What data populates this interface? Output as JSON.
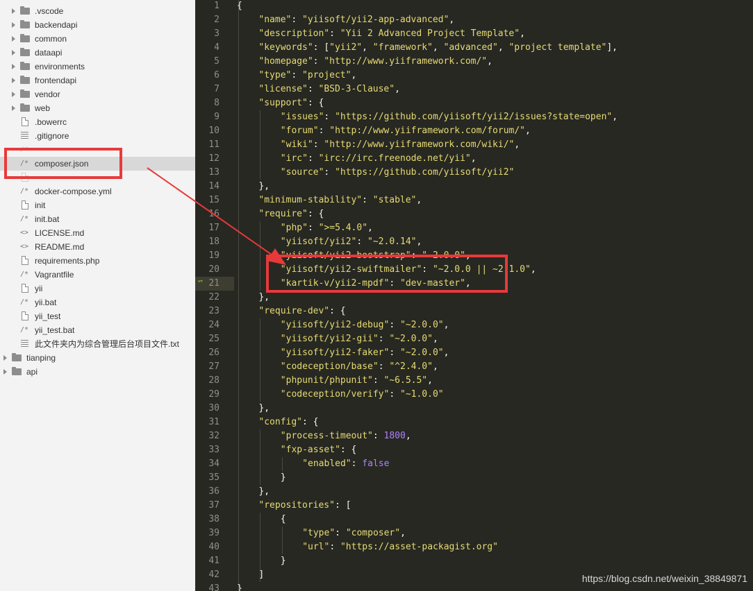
{
  "sidebar": {
    "items": [
      {
        "kind": "folder",
        "depth": 1,
        "label": ".vscode"
      },
      {
        "kind": "folder",
        "depth": 1,
        "label": "backendapi"
      },
      {
        "kind": "folder",
        "depth": 1,
        "label": "common"
      },
      {
        "kind": "folder",
        "depth": 1,
        "label": "dataapi"
      },
      {
        "kind": "folder",
        "depth": 1,
        "label": "environments"
      },
      {
        "kind": "folder",
        "depth": 1,
        "label": "frontendapi"
      },
      {
        "kind": "folder",
        "depth": 1,
        "label": "vendor"
      },
      {
        "kind": "folder",
        "depth": 1,
        "label": "web"
      },
      {
        "kind": "file",
        "depth": 1,
        "label": ".bowerrc"
      },
      {
        "kind": "lines",
        "depth": 1,
        "label": ".gitignore"
      },
      {
        "kind": "comment",
        "depth": 1,
        "label": "",
        "partial": true
      },
      {
        "kind": "comment",
        "depth": 1,
        "label": "composer.json",
        "selected": true
      },
      {
        "kind": "file",
        "depth": 1,
        "label": "",
        "partial": true
      },
      {
        "kind": "comment",
        "depth": 1,
        "label": "docker-compose.yml"
      },
      {
        "kind": "file",
        "depth": 1,
        "label": "init"
      },
      {
        "kind": "comment",
        "depth": 1,
        "label": "init.bat"
      },
      {
        "kind": "code",
        "depth": 1,
        "label": "LICENSE.md"
      },
      {
        "kind": "code",
        "depth": 1,
        "label": "README.md"
      },
      {
        "kind": "file",
        "depth": 1,
        "label": "requirements.php"
      },
      {
        "kind": "comment",
        "depth": 1,
        "label": "Vagrantfile"
      },
      {
        "kind": "file",
        "depth": 1,
        "label": "yii"
      },
      {
        "kind": "comment",
        "depth": 1,
        "label": "yii.bat"
      },
      {
        "kind": "file",
        "depth": 1,
        "label": "yii_test"
      },
      {
        "kind": "comment",
        "depth": 1,
        "label": "yii_test.bat"
      },
      {
        "kind": "lines",
        "depth": 1,
        "label": "此文件夹内为综合管理后台项目文件.txt"
      },
      {
        "kind": "folder",
        "depth": 0,
        "label": "tianping"
      },
      {
        "kind": "folder",
        "depth": 0,
        "label": "api"
      }
    ]
  },
  "editor": {
    "current_line": 21,
    "lines": [
      [
        [
          "p",
          "{"
        ]
      ],
      [
        [
          "s",
          "\"name\""
        ],
        [
          "p",
          ": "
        ],
        [
          "s",
          "\"yiisoft/yii2-app-advanced\""
        ],
        [
          "p",
          ","
        ]
      ],
      [
        [
          "s",
          "\"description\""
        ],
        [
          "p",
          ": "
        ],
        [
          "s",
          "\"Yii 2 Advanced Project Template\""
        ],
        [
          "p",
          ","
        ]
      ],
      [
        [
          "s",
          "\"keywords\""
        ],
        [
          "p",
          ": ["
        ],
        [
          "s",
          "\"yii2\""
        ],
        [
          "p",
          ", "
        ],
        [
          "s",
          "\"framework\""
        ],
        [
          "p",
          ", "
        ],
        [
          "s",
          "\"advanced\""
        ],
        [
          "p",
          ", "
        ],
        [
          "s",
          "\"project template\""
        ],
        [
          "p",
          "],"
        ]
      ],
      [
        [
          "s",
          "\"homepage\""
        ],
        [
          "p",
          ": "
        ],
        [
          "s",
          "\"http://www.yiiframework.com/\""
        ],
        [
          "p",
          ","
        ]
      ],
      [
        [
          "s",
          "\"type\""
        ],
        [
          "p",
          ": "
        ],
        [
          "s",
          "\"project\""
        ],
        [
          "p",
          ","
        ]
      ],
      [
        [
          "s",
          "\"license\""
        ],
        [
          "p",
          ": "
        ],
        [
          "s",
          "\"BSD-3-Clause\""
        ],
        [
          "p",
          ","
        ]
      ],
      [
        [
          "s",
          "\"support\""
        ],
        [
          "p",
          ": {"
        ]
      ],
      [
        [
          "s",
          "\"issues\""
        ],
        [
          "p",
          ": "
        ],
        [
          "s",
          "\"https://github.com/yiisoft/yii2/issues?state=open\""
        ],
        [
          "p",
          ","
        ]
      ],
      [
        [
          "s",
          "\"forum\""
        ],
        [
          "p",
          ": "
        ],
        [
          "s",
          "\"http://www.yiiframework.com/forum/\""
        ],
        [
          "p",
          ","
        ]
      ],
      [
        [
          "s",
          "\"wiki\""
        ],
        [
          "p",
          ": "
        ],
        [
          "s",
          "\"http://www.yiiframework.com/wiki/\""
        ],
        [
          "p",
          ","
        ]
      ],
      [
        [
          "s",
          "\"irc\""
        ],
        [
          "p",
          ": "
        ],
        [
          "s",
          "\"irc://irc.freenode.net/yii\""
        ],
        [
          "p",
          ","
        ]
      ],
      [
        [
          "s",
          "\"source\""
        ],
        [
          "p",
          ": "
        ],
        [
          "s",
          "\"https://github.com/yiisoft/yii2\""
        ]
      ],
      [
        [
          "p",
          "},"
        ]
      ],
      [
        [
          "s",
          "\"minimum-stability\""
        ],
        [
          "p",
          ": "
        ],
        [
          "s",
          "\"stable\""
        ],
        [
          "p",
          ","
        ]
      ],
      [
        [
          "s",
          "\"require\""
        ],
        [
          "p",
          ": {"
        ]
      ],
      [
        [
          "s",
          "\"php\""
        ],
        [
          "p",
          ": "
        ],
        [
          "s",
          "\">=5.4.0\""
        ],
        [
          "p",
          ","
        ]
      ],
      [
        [
          "s",
          "\"yiisoft/yii2\""
        ],
        [
          "p",
          ": "
        ],
        [
          "s",
          "\"~2.0.14\""
        ],
        [
          "p",
          ","
        ]
      ],
      [
        [
          "s",
          "\"yiisoft/yii2-bootstrap\""
        ],
        [
          "p",
          ": "
        ],
        [
          "s",
          "\"~2.0.0\""
        ],
        [
          "p",
          ","
        ]
      ],
      [
        [
          "s",
          "\"yiisoft/yii2-swiftmailer\""
        ],
        [
          "p",
          ": "
        ],
        [
          "s",
          "\"~2.0.0 || ~2.1.0\""
        ],
        [
          "p",
          ","
        ]
      ],
      [
        [
          "s",
          "\"kartik-v/yii2-mpdf\""
        ],
        [
          "p",
          ": "
        ],
        [
          "s",
          "\"dev-master\""
        ],
        [
          "p",
          ","
        ]
      ],
      [
        [
          "p",
          "},"
        ]
      ],
      [
        [
          "s",
          "\"require-dev\""
        ],
        [
          "p",
          ": {"
        ]
      ],
      [
        [
          "s",
          "\"yiisoft/yii2-debug\""
        ],
        [
          "p",
          ": "
        ],
        [
          "s",
          "\"~2.0.0\""
        ],
        [
          "p",
          ","
        ]
      ],
      [
        [
          "s",
          "\"yiisoft/yii2-gii\""
        ],
        [
          "p",
          ": "
        ],
        [
          "s",
          "\"~2.0.0\""
        ],
        [
          "p",
          ","
        ]
      ],
      [
        [
          "s",
          "\"yiisoft/yii2-faker\""
        ],
        [
          "p",
          ": "
        ],
        [
          "s",
          "\"~2.0.0\""
        ],
        [
          "p",
          ","
        ]
      ],
      [
        [
          "s",
          "\"codeception/base\""
        ],
        [
          "p",
          ": "
        ],
        [
          "s",
          "\"^2.4.0\""
        ],
        [
          "p",
          ","
        ]
      ],
      [
        [
          "s",
          "\"phpunit/phpunit\""
        ],
        [
          "p",
          ": "
        ],
        [
          "s",
          "\"~6.5.5\""
        ],
        [
          "p",
          ","
        ]
      ],
      [
        [
          "s",
          "\"codeception/verify\""
        ],
        [
          "p",
          ": "
        ],
        [
          "s",
          "\"~1.0.0\""
        ]
      ],
      [
        [
          "p",
          "},"
        ]
      ],
      [
        [
          "s",
          "\"config\""
        ],
        [
          "p",
          ": {"
        ]
      ],
      [
        [
          "s",
          "\"process-timeout\""
        ],
        [
          "p",
          ": "
        ],
        [
          "n",
          "1800"
        ],
        [
          "p",
          ","
        ]
      ],
      [
        [
          "s",
          "\"fxp-asset\""
        ],
        [
          "p",
          ": {"
        ]
      ],
      [
        [
          "s",
          "\"enabled\""
        ],
        [
          "p",
          ": "
        ],
        [
          "n",
          "false"
        ]
      ],
      [
        [
          "p",
          "}"
        ]
      ],
      [
        [
          "p",
          "},"
        ]
      ],
      [
        [
          "s",
          "\"repositories\""
        ],
        [
          "p",
          ": ["
        ]
      ],
      [
        [
          "p",
          "{"
        ]
      ],
      [
        [
          "s",
          "\"type\""
        ],
        [
          "p",
          ": "
        ],
        [
          "s",
          "\"composer\""
        ],
        [
          "p",
          ","
        ]
      ],
      [
        [
          "s",
          "\"url\""
        ],
        [
          "p",
          ": "
        ],
        [
          "s",
          "\"https://asset-packagist.org\""
        ]
      ],
      [
        [
          "p",
          "}"
        ]
      ],
      [
        [
          "p",
          "]"
        ]
      ],
      [
        [
          "p",
          "}"
        ]
      ]
    ],
    "indents": [
      0,
      1,
      1,
      1,
      1,
      1,
      1,
      1,
      2,
      2,
      2,
      2,
      2,
      1,
      1,
      1,
      2,
      2,
      2,
      2,
      2,
      1,
      1,
      2,
      2,
      2,
      2,
      2,
      2,
      1,
      1,
      2,
      2,
      3,
      2,
      1,
      1,
      2,
      3,
      3,
      2,
      1,
      0
    ],
    "marker": "“”"
  },
  "watermark": "https://blog.csdn.net/weixin_38849871",
  "colors": {
    "annotation": "#e8393a",
    "string": "#e6db74",
    "number": "#ae81ff",
    "background": "#272822"
  }
}
